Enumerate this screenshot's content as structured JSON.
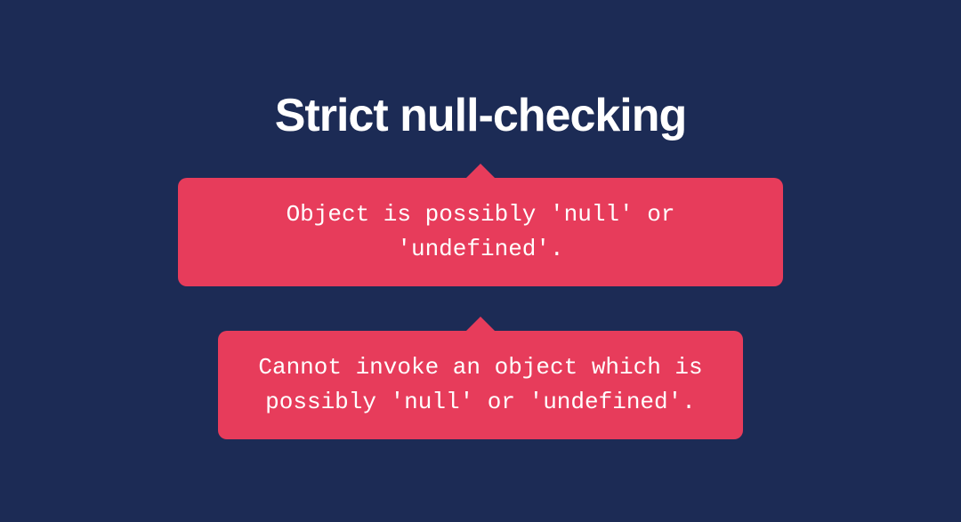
{
  "title": "Strict null-checking",
  "errors": [
    "Object is possibly 'null' or 'undefined'.",
    "Cannot invoke an object which is possibly 'null' or 'undefined'."
  ]
}
